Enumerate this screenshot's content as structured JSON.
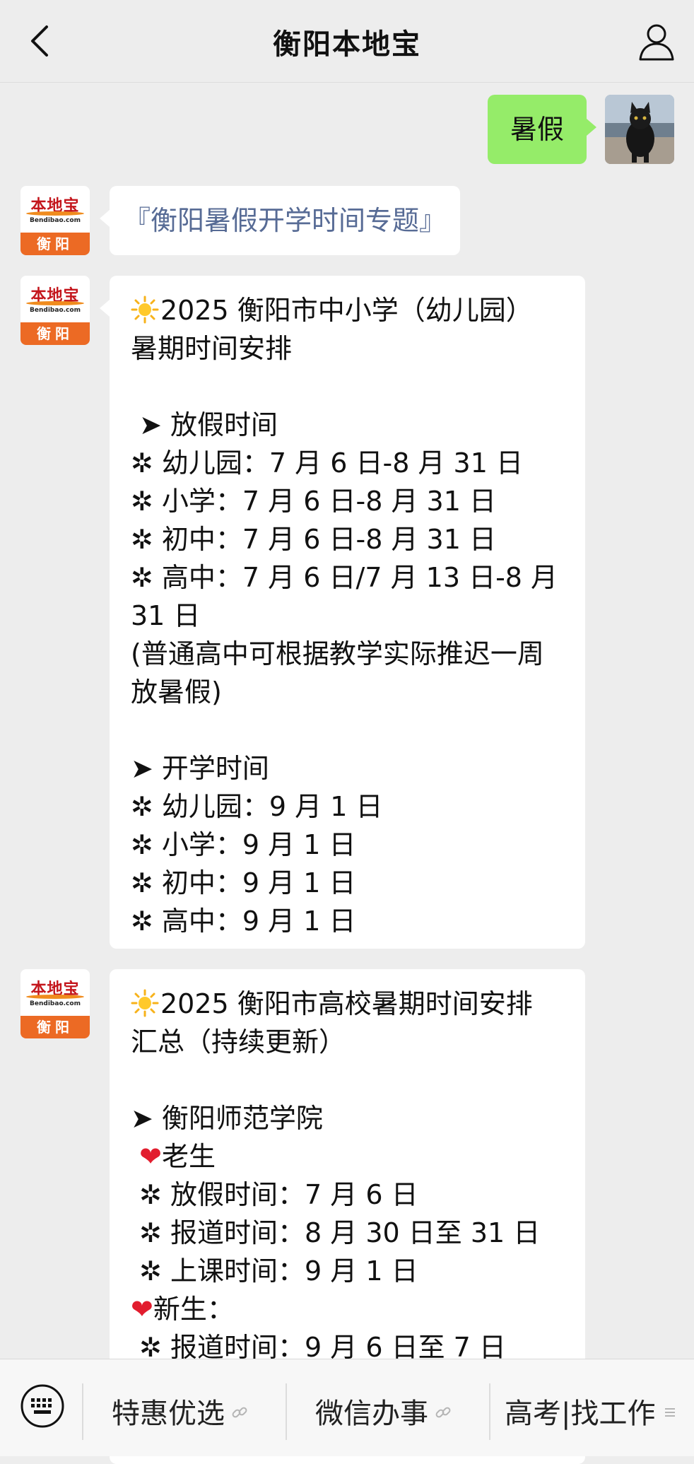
{
  "header": {
    "title": "衡阳本地宝",
    "back_icon": "chevron-left-icon",
    "profile_icon": "person-icon"
  },
  "user_message": {
    "text": "暑假"
  },
  "account_avatar": {
    "brand": "本地宝",
    "url": "Bendibao.com",
    "city": "衡阳"
  },
  "topic_message": {
    "text": "『衡阳暑假开学时间专题』"
  },
  "message_k12": {
    "lines": [
      "2025 衡阳市中小学（幼儿园）",
      "暑期时间安排",
      "",
      " ➤ 放假时间",
      "✲ 幼儿园：7 月 6 日-8 月 31 日",
      "✲ 小学：7 月 6 日-8 月 31 日",
      "✲ 初中：7 月 6 日-8 月 31 日",
      "✲ 高中：7 月 6 日/7 月 13 日-8 月",
      "31 日",
      "(普通高中可根据教学实际推迟一周",
      "放暑假)",
      "",
      "➤ 开学时间",
      "✲ 幼儿园：9 月 1 日",
      "✲ 小学：9 月 1 日",
      "✲ 初中：9 月 1 日",
      "✲ 高中：9 月 1 日"
    ]
  },
  "message_college": {
    "lines": [
      "2025 衡阳市高校暑期时间安排",
      "汇总（持续更新）",
      "",
      "➤ 衡阳师范学院",
      "老生",
      " ✲ 放假时间：7 月 6 日",
      " ✲ 报道时间：8 月 30 日至 31 日",
      " ✲ 上课时间：9 月 1 日",
      "新生：",
      " ✲ 报道时间：9 月 6 日至 7 日"
    ],
    "heart_symbol": "❤"
  },
  "bottom_menu": {
    "keyboard_icon": "keyboard-icon",
    "items": [
      "特惠优选",
      "微信办事",
      "高考|找工作"
    ],
    "link_icon": "link-icon",
    "more_icon": "menu-lines-icon"
  },
  "colors": {
    "background": "#ededed",
    "user_bubble": "#95ec69",
    "link_blue": "#576b95",
    "brand_orange": "#ec6a24",
    "heart_red": "#e21d2e"
  }
}
